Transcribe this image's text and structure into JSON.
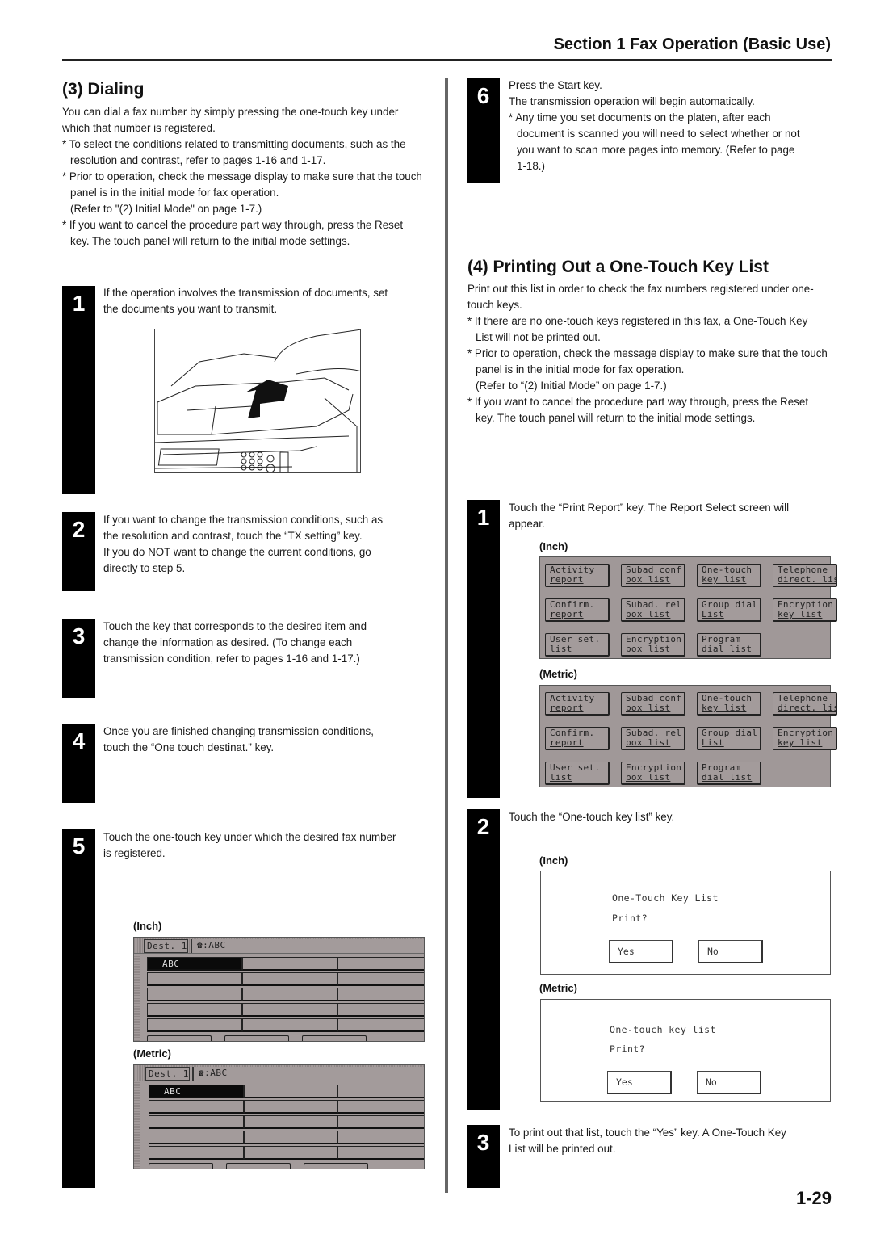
{
  "header": {
    "title": "Section 1  Fax Operation (Basic Use)"
  },
  "dialing": {
    "title": "(3) Dialing",
    "intro": "You can dial a fax number by simply pressing the one-touch key under which that number is registered.",
    "notes": [
      "* To select the conditions related to transmitting documents, such as the resolution and contrast, refer to pages 1-16 and 1-17.",
      "* Prior to operation, check the message display to make sure that the touch panel is in the initial mode for fax operation.",
      "* If you want to cancel the procedure part way through, press the Reset key. The touch panel will return to the initial mode settings."
    ],
    "refer": "(Refer to \"(2) Initial Mode\" on page 1-7.)",
    "steps": [
      {
        "num": "1",
        "lines": [
          "If the operation involves the transmission of documents, set",
          "the documents you want to transmit."
        ]
      },
      {
        "num": "2",
        "lines": [
          "If you want to change the transmission conditions, such as",
          "the resolution and contrast, touch the “TX setting” key.",
          "If you do NOT want to change the current conditions, go",
          "directly to step 5."
        ]
      },
      {
        "num": "3",
        "lines": [
          "Touch the key that corresponds to the desired item and",
          "change the information as desired. (To change each",
          "transmission condition, refer to pages 1-16 and 1-17.)"
        ]
      },
      {
        "num": "4",
        "lines": [
          "Once you are finished changing transmission conditions,",
          "touch the “One touch destinat.” key."
        ]
      },
      {
        "num": "5",
        "lines": [
          "Touch the one-touch key under which the desired fax number",
          "is registered."
        ]
      },
      {
        "num": "6",
        "lines": [
          "Press the Start key.",
          "The transmission operation will begin automatically.",
          "* Any time you set documents on the platen, after each",
          "document is scanned you will need to select whether or not",
          "you want to scan more pages into memory. (Refer to page",
          "1-18.)"
        ]
      }
    ],
    "onetouch_panels": [
      {
        "label": "(Inch)",
        "dest": "Dest. 1",
        "tel_icon": "telephone-icon",
        "tel_value": ":ABC",
        "selected_key": "ABC"
      },
      {
        "label": "(Metric)",
        "dest": "Dest. 1",
        "tel_icon": "telephone-icon",
        "tel_value": ":ABC",
        "selected_key": "ABC"
      }
    ]
  },
  "printing": {
    "title": "(4) Printing Out a One-Touch Key List",
    "intro": "Print out this list in order to check the fax numbers registered under one-touch keys.",
    "notes": [
      "* If there are no one-touch keys registered in this fax, a One-Touch Key List will not be printed out.",
      "* Prior to operation, check the message display to make sure that the touch panel is in the initial mode for fax operation.",
      "* If you want to cancel the procedure part way through, press the Reset key. The touch panel will return to the initial mode settings."
    ],
    "refer": "(Refer to “(2) Initial Mode” on page 1-7.)",
    "steps": [
      {
        "num": "1",
        "lines": [
          "Touch the “Print Report” key. The Report Select screen will",
          "appear."
        ]
      },
      {
        "num": "2",
        "lines": [
          "Touch the “One-touch key list” key."
        ]
      },
      {
        "num": "3",
        "lines": [
          "To print out that list, touch the “Yes” key. A One-Touch Key",
          "List will be printed out."
        ]
      }
    ],
    "report_panels": [
      {
        "label": "(Inch)",
        "keys": [
          [
            "Activity",
            "report"
          ],
          [
            "Subad conf",
            "box list"
          ],
          [
            "One-touch",
            "key list"
          ],
          [
            "Telephone",
            "direct. list"
          ],
          [
            "Confirm.",
            "report"
          ],
          [
            "Subad. rel",
            "box list"
          ],
          [
            "Group dial",
            "List"
          ],
          [
            "Encryption",
            "key list"
          ],
          [
            "User set.",
            "list"
          ],
          [
            "Encryption",
            "box list"
          ],
          [
            "Program",
            "dial list"
          ]
        ]
      },
      {
        "label": "(Metric)",
        "keys": [
          [
            "Activity",
            "report"
          ],
          [
            "Subad conf",
            "box list"
          ],
          [
            "One-touch",
            "key list"
          ],
          [
            "Telephone",
            "direct. list"
          ],
          [
            "Confirm.",
            "report"
          ],
          [
            "Subad. rel",
            "box list"
          ],
          [
            "Group dial",
            "List"
          ],
          [
            "Encryption",
            "key list"
          ],
          [
            "User set.",
            "list"
          ],
          [
            "Encryption",
            "box list"
          ],
          [
            "Program",
            "dial list"
          ]
        ]
      }
    ],
    "dialogs": [
      {
        "label": "(Inch)",
        "title": "One-Touch Key List",
        "question": "Print?",
        "yes": "Yes",
        "no": "No"
      },
      {
        "label": "(Metric)",
        "title": "One-touch key list",
        "question": "Print?",
        "yes": "Yes",
        "no": "No"
      }
    ]
  },
  "page_number": "1-29"
}
